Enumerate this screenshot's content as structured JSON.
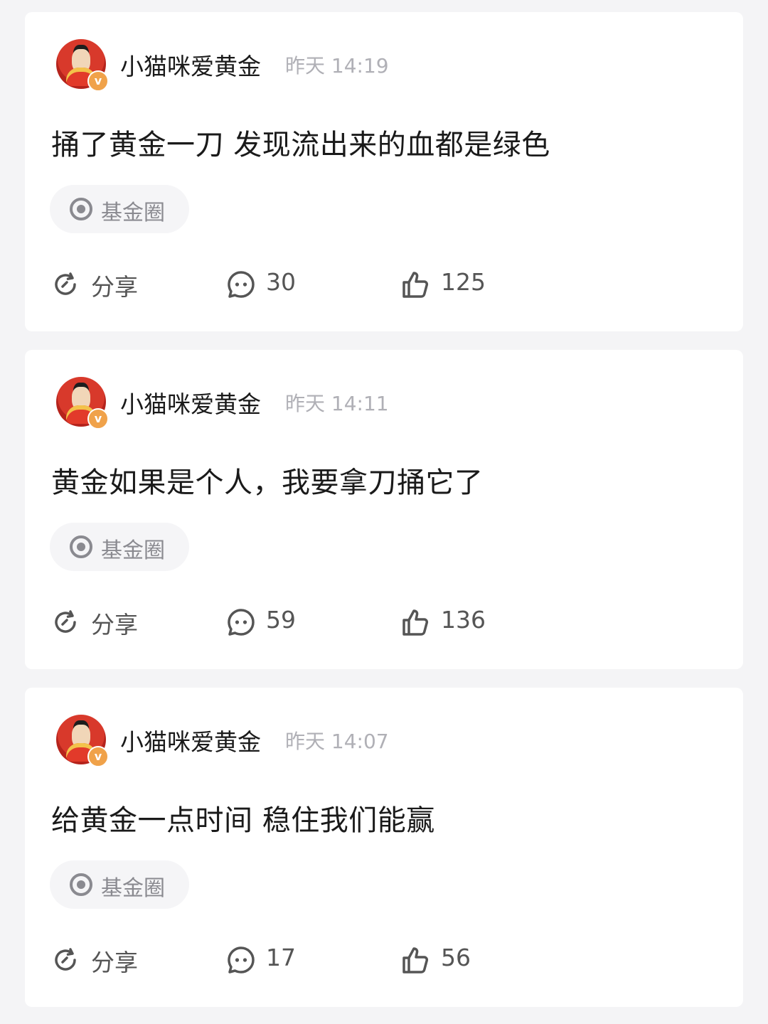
{
  "posts": [
    {
      "username": "小猫咪爱黄金",
      "time": "昨天 14:19",
      "content": "捅了黄金一刀 发现流出来的血都是绿色",
      "tag": "基金圈",
      "share_label": "分享",
      "comments": "30",
      "likes": "125"
    },
    {
      "username": "小猫咪爱黄金",
      "time": "昨天 14:11",
      "content": "黄金如果是个人，我要拿刀捅它了",
      "tag": "基金圈",
      "share_label": "分享",
      "comments": "59",
      "likes": "136"
    },
    {
      "username": "小猫咪爱黄金",
      "time": "昨天 14:07",
      "content": "给黄金一点时间 稳住我们能赢",
      "tag": "基金圈",
      "share_label": "分享",
      "comments": "17",
      "likes": "56"
    }
  ],
  "badge_text": "v",
  "colors": {
    "background": "#f4f4f6",
    "card": "#ffffff",
    "badge": "#f0a24a",
    "muted_text": "#b0b0b6",
    "tag_bg": "#f5f5f7"
  }
}
